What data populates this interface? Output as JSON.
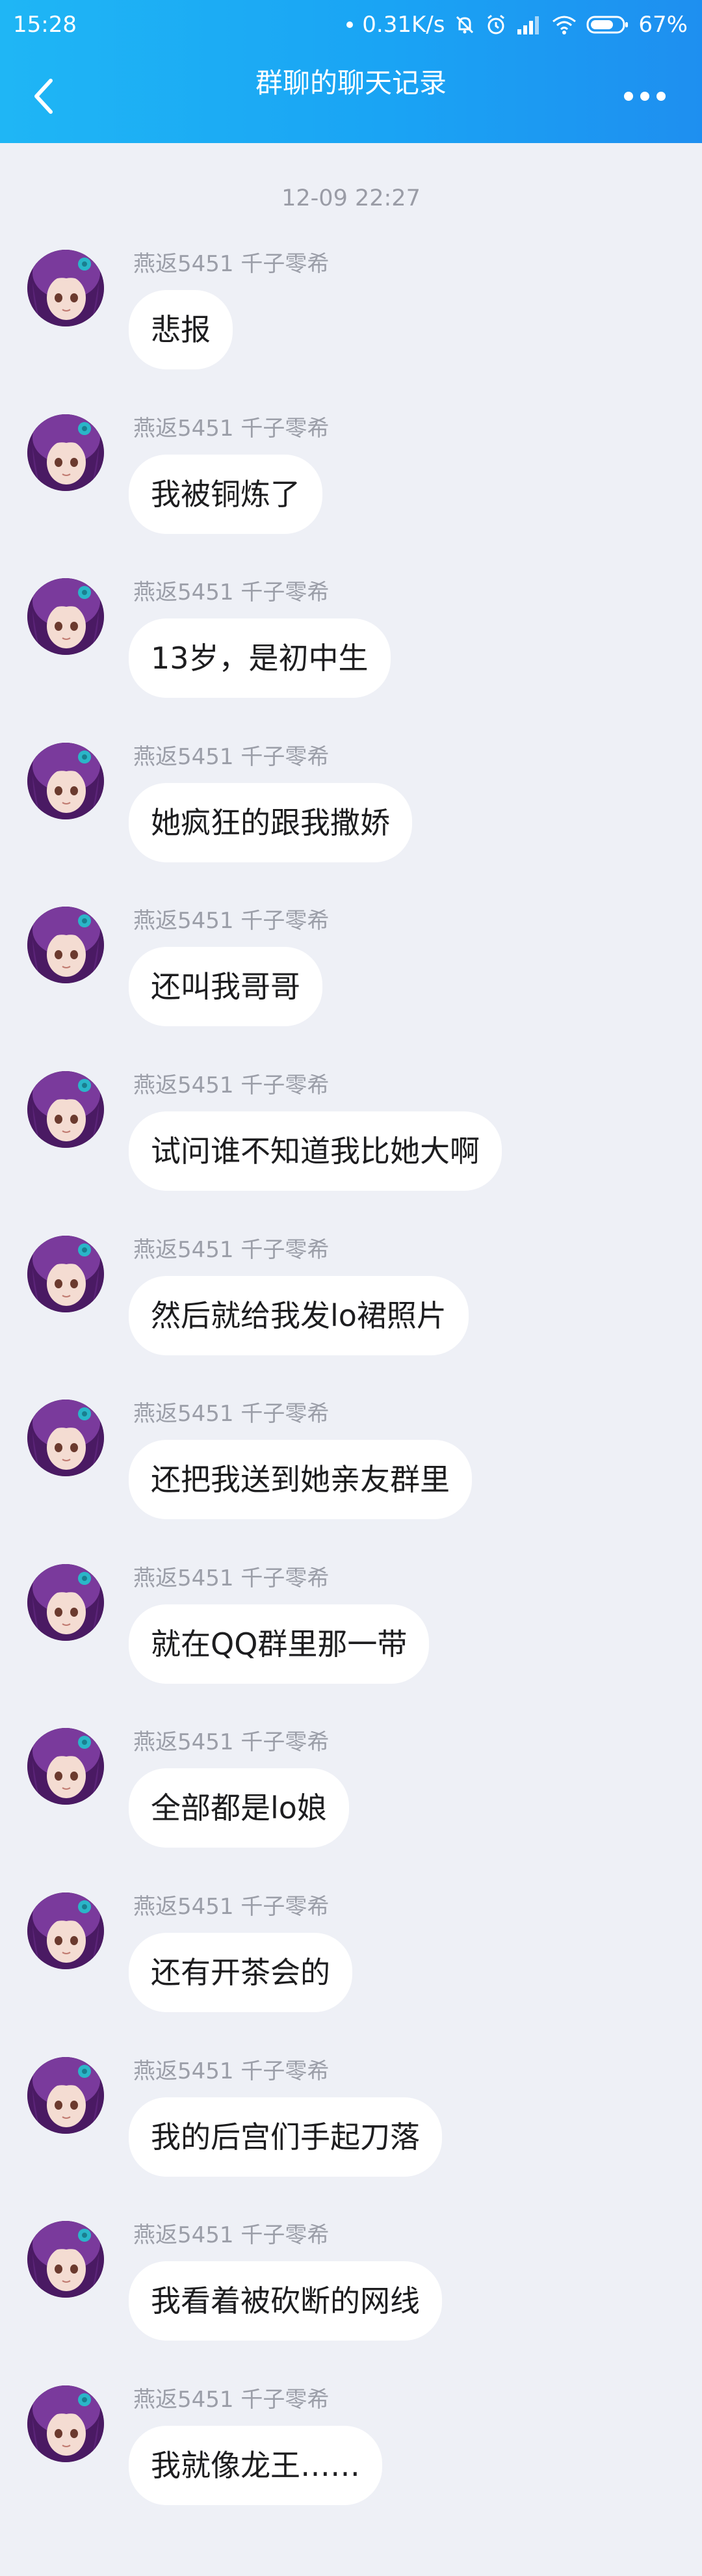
{
  "status_bar": {
    "time": "15:28",
    "network_speed": "0.31K/s",
    "battery": "67%"
  },
  "header": {
    "title": "群聊的聊天记录",
    "back_icon": "chevron-left-icon",
    "more_icon": "more-dots-icon"
  },
  "date_stamp": "12-09 22:27",
  "sender_name": "燕返5451 千子零希",
  "messages": [
    {
      "sender": "燕返5451 千子零希",
      "text": "悲报"
    },
    {
      "sender": "燕返5451 千子零希",
      "text": "我被铜炼了"
    },
    {
      "sender": "燕返5451 千子零希",
      "text": "13岁，是初中生"
    },
    {
      "sender": "燕返5451 千子零希",
      "text": "她疯狂的跟我撒娇"
    },
    {
      "sender": "燕返5451 千子零希",
      "text": "还叫我哥哥"
    },
    {
      "sender": "燕返5451 千子零希",
      "text": "试问谁不知道我比她大啊"
    },
    {
      "sender": "燕返5451 千子零希",
      "text": "然后就给我发lo裙照片"
    },
    {
      "sender": "燕返5451 千子零希",
      "text": "还把我送到她亲友群里"
    },
    {
      "sender": "燕返5451 千子零希",
      "text": "就在QQ群里那一带"
    },
    {
      "sender": "燕返5451 千子零希",
      "text": "全部都是lo娘"
    },
    {
      "sender": "燕返5451 千子零希",
      "text": "还有开茶会的"
    },
    {
      "sender": "燕返5451 千子零希",
      "text": "我的后宫们手起刀落"
    },
    {
      "sender": "燕返5451 千子零希",
      "text": "我看着被砍断的网线"
    },
    {
      "sender": "燕返5451 千子零希",
      "text": "我就像龙王……"
    }
  ],
  "colors": {
    "header_start": "#1fb6f5",
    "header_end": "#1e8ff0",
    "background": "#eef0f6",
    "bubble": "#ffffff",
    "meta_text": "#9b9ea8"
  }
}
